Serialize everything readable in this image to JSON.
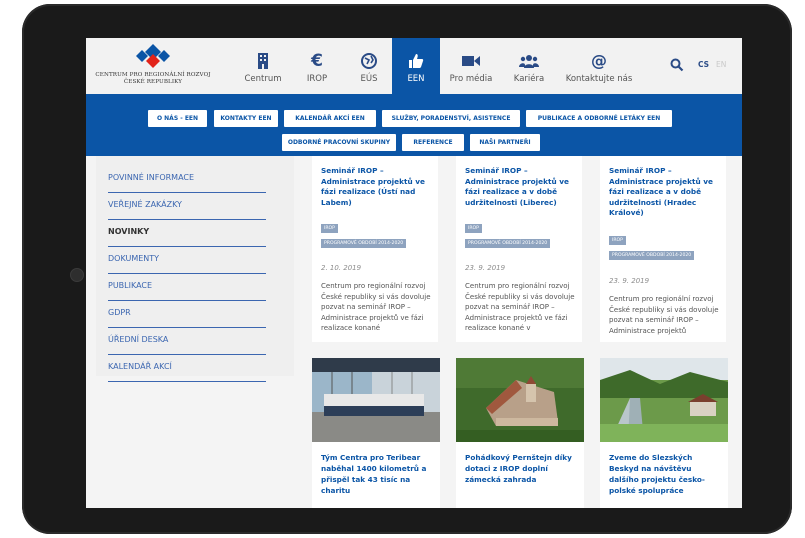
{
  "header": {
    "logo_text_line1": "CENTRUM PRO REGIONÁLNÍ ROZVOJ",
    "logo_text_line2": "ČESKÉ REPUBLIKY",
    "nav": [
      {
        "label": "Centrum",
        "icon": "building-icon"
      },
      {
        "label": "IROP",
        "icon": "euro-icon"
      },
      {
        "label": "EÚS",
        "icon": "globe-icon"
      },
      {
        "label": "EEN",
        "icon": "thumbs-up-icon",
        "active": true
      },
      {
        "label": "Pro média",
        "icon": "video-camera-icon"
      },
      {
        "label": "Kariéra",
        "icon": "people-icon"
      },
      {
        "label": "Kontaktujte nás",
        "icon": "at-icon"
      }
    ],
    "lang_cs": "CS",
    "lang_en": "EN"
  },
  "subnav": {
    "row1": [
      "O NÁS - EEN",
      "KONTAKTY EEN",
      "KALENDÁŘ AKCÍ EEN",
      "SLUŽBY, PORADENSTVÍ, ASISTENCE",
      "PUBLIKACE A ODBORNÉ LETÁKY EEN"
    ],
    "row2": [
      "ODBORNÉ PRACOVNÍ SKUPINY",
      "REFERENCE",
      "NAŠI PARTNEŘI"
    ]
  },
  "sidebar": {
    "items": [
      "POVINNÉ INFORMACE",
      "VEŘEJNÉ ZAKÁZKY",
      "NOVINKY",
      "DOKUMENTY",
      "PUBLIKACE",
      "GDPR",
      "ÚŘEDNÍ DESKA",
      "KALENDÁŘ AKCÍ"
    ]
  },
  "cards": [
    {
      "title": "Seminář IROP – Administrace projektů ve fázi realizace (Ústí nad Labem)",
      "tags": [
        "IROP",
        "PROGRAMOVÉ OBDOBÍ 2014-2020"
      ],
      "date": "2. 10. 2019",
      "excerpt": "Centrum pro regionální rozvoj České republiky si vás dovoluje pozvat na seminář IROP – Administrace projektů ve fázi realizace konané"
    },
    {
      "title": "Seminář IROP – Administrace projektů ve fázi realizace a v době udržitelnosti (Liberec)",
      "tags": [
        "IROP",
        "PROGRAMOVÉ OBDOBÍ 2014-2020"
      ],
      "date": "23. 9. 2019",
      "excerpt": "Centrum pro regionální rozvoj České republiky si vás dovoluje pozvat na seminář IROP – Administrace projektů ve fázi realizace konané v"
    },
    {
      "title": "Seminář IROP – Administrace projektů ve fázi realizace a v době udržitelnosti (Hradec Králové)",
      "tags": [
        "IROP",
        "PROGRAMOVÉ OBDOBÍ 2014-2020"
      ],
      "date": "23. 9. 2019",
      "excerpt": "Centrum pro regionální rozvoj České republiky si vás dovoluje pozvat na seminář IROP – Administrace projektů"
    }
  ],
  "photo_cards": [
    {
      "title": "Tým Centra pro Teribear naběhal 1400 kilometrů a přispěl tak 43 tisíc na charitu",
      "image": "team-photo"
    },
    {
      "title": "Pohádkový Pernštejn díky dotaci z IROP doplní zámecká zahrada",
      "image": "castle-photo"
    },
    {
      "title": "Zveme do Slezských Beskyd na návštěvu dalšího projektu česko-polské spolupráce",
      "image": "landscape-photo"
    }
  ],
  "colors": {
    "brand_blue": "#0b55a6",
    "logo_red": "#e2231a",
    "tag_grey": "#8ea3bf"
  }
}
